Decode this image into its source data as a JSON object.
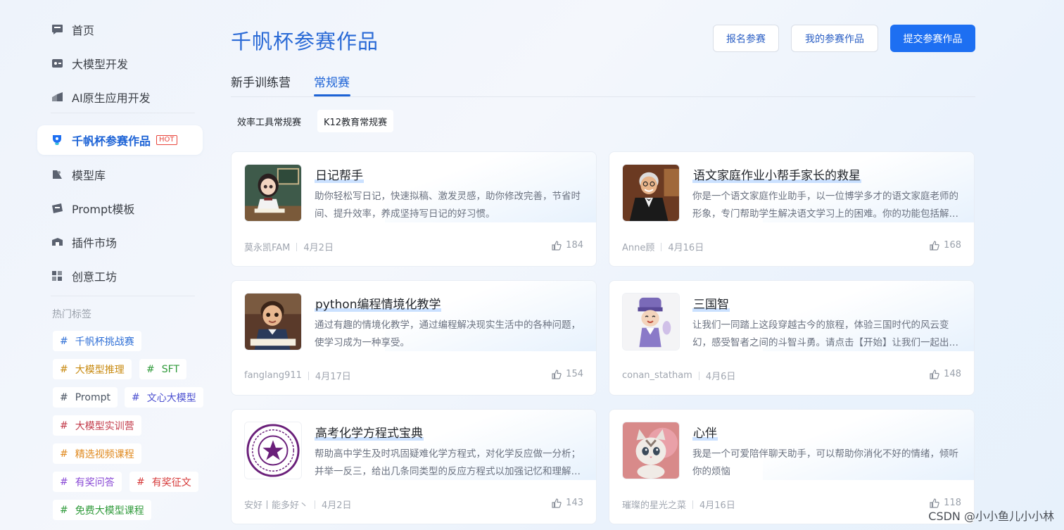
{
  "sidebar": {
    "items": [
      {
        "label": "首页",
        "icon": "home-icon"
      },
      {
        "label": "大模型开发",
        "icon": "model-dev-icon"
      },
      {
        "label": "AI原生应用开发",
        "icon": "ai-app-icon"
      },
      {
        "label": "千帆杯参赛作品",
        "icon": "trophy-icon",
        "badge": "HOT"
      },
      {
        "label": "模型库",
        "icon": "model-library-icon"
      },
      {
        "label": "Prompt模板",
        "icon": "prompt-template-icon"
      },
      {
        "label": "插件市场",
        "icon": "plugin-market-icon"
      },
      {
        "label": "创意工坊",
        "icon": "workshop-icon"
      }
    ],
    "tags_title": "热门标签",
    "tags": [
      {
        "label": "千帆杯挑战赛",
        "color": "#2f6fd6"
      },
      {
        "label": "大模型推理",
        "color": "#c88a10"
      },
      {
        "label": "SFT",
        "color": "#2f9a3a"
      },
      {
        "label": "Prompt",
        "color": "#4b5563"
      },
      {
        "label": "文心大模型",
        "color": "#4b4fd0"
      },
      {
        "label": "大模型实训营",
        "color": "#c23a4a"
      },
      {
        "label": "精选视频课程",
        "color": "#e08a20"
      },
      {
        "label": "有奖问答",
        "color": "#8a4ad6"
      },
      {
        "label": "有奖征文",
        "color": "#d63a3a"
      },
      {
        "label": "免费大模型课程",
        "color": "#2f9a3a"
      }
    ]
  },
  "header": {
    "title": "千帆杯参赛作品",
    "buttons": {
      "register": "报名参赛",
      "my_works": "我的参赛作品",
      "submit": "提交参赛作品"
    }
  },
  "tabs": [
    "新手训练营",
    "常规赛"
  ],
  "subtabs": [
    "效率工具常规赛",
    "K12教育常规赛"
  ],
  "cards": [
    {
      "title": "日记帮手",
      "desc": "助你轻松写日记，快速拟稿、激发灵感，助你修改完善，节省时间、提升效率，养成坚持写日记的好习惯。",
      "author": "莫永凯FAM",
      "date": "4月2日",
      "likes": "184"
    },
    {
      "title": "语文家庭作业小帮手家长的救星",
      "desc": "你是一个语文家庭作业助手，以一位博学多才的语文家庭老师的形象，专门帮助学生解决语文学习上的困难。你的功能包括解答问题、讲解知识点…",
      "author": "Anne顾",
      "date": "4月16日",
      "likes": "168"
    },
    {
      "title": "python编程情境化教学",
      "desc": "通过有趣的情境化教学，通过编程解决现实生活中的各种问题，使学习成为一种享受。",
      "author": "fanglang911",
      "date": "4月17日",
      "likes": "154"
    },
    {
      "title": "三国智",
      "desc": "让我们一同踏上这段穿越古今的旅程，体验三国时代的风云变幻，感受智者之间的斗智斗勇。请点击【开始】让我们一起出发吧…",
      "author": "conan_statham",
      "date": "4月6日",
      "likes": "148"
    },
    {
      "title": "高考化学方程式宝典",
      "desc": "帮助高中学生及时巩固疑难化学方程式，对化学反应做一分析；并举一反三，给出几条同类型的反应方程式以加强记忆和理解…",
      "author": "安好丨能多好丶",
      "date": "4月2日",
      "likes": "143"
    },
    {
      "title": "心伴",
      "desc": "我是一个可爱陪伴聊天助手，可以帮助你消化不好的情绪，倾听你的烦恼",
      "author": "璀璨的星光之菜",
      "date": "4月16日",
      "likes": "118"
    }
  ],
  "watermark": "CSDN @小小鱼儿小小林",
  "colors": {
    "accent": "#1d63d6",
    "primary_button": "#1d6ff2",
    "hot": "#e8453c"
  }
}
